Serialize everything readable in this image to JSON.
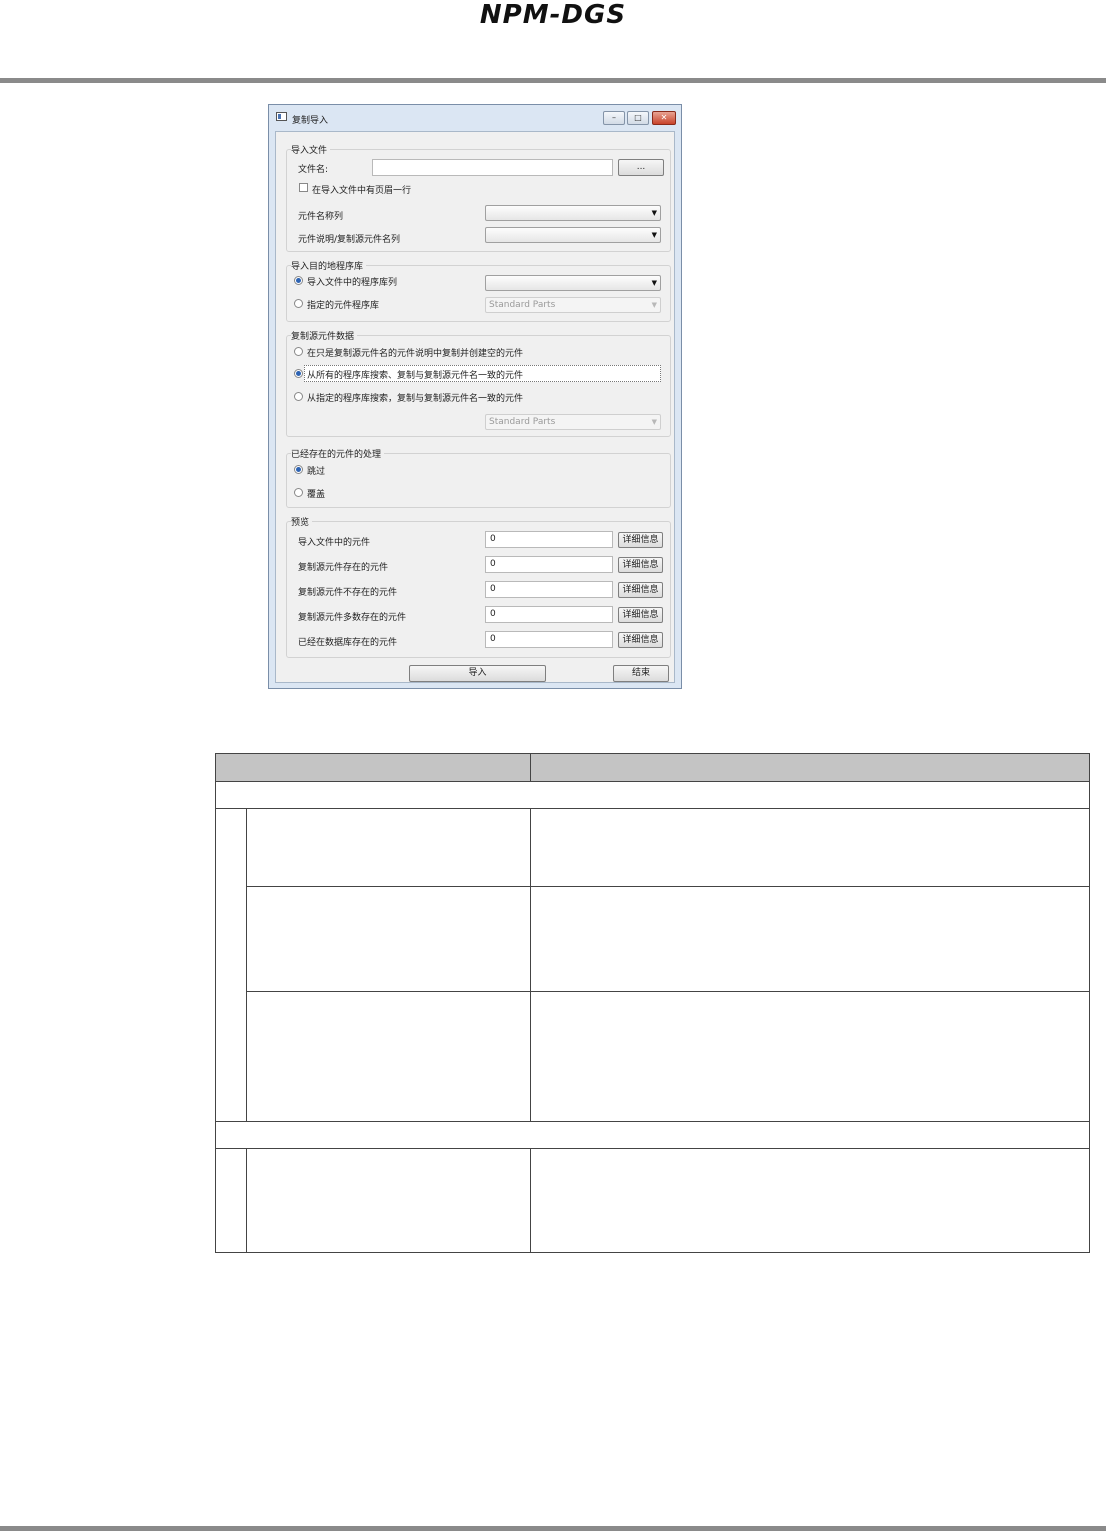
{
  "header": {
    "title": "NPM-DGS"
  },
  "dialog": {
    "title": "复制导入",
    "window_buttons": {
      "minimize": "–",
      "maximize": "□",
      "close": "✕"
    },
    "import_file_group": {
      "title": "导入文件",
      "filename_label": "文件名:",
      "filename_value": "",
      "browse_label": "...",
      "header_row_checkbox_label": "在导入文件中有页眉一行",
      "header_row_checked": false,
      "component_name_col_label": "元件名称列",
      "component_name_col_value": "",
      "description_col_label": "元件说明/复制源元件名列",
      "description_col_value": ""
    },
    "destination_group": {
      "title": "导入目的地程序库",
      "option_file_label": "导入文件中的程序库列",
      "option_file_selected": true,
      "option_file_combo_value": "",
      "option_specified_label": "指定的元件程序库",
      "option_specified_selected": false,
      "option_specified_combo_value": "Standard Parts"
    },
    "copy_source_group": {
      "title": "复制源元件数据",
      "option1_label": "在只是复制源元件名的元件说明中复制并创建空的元件",
      "option2_label": "从所有的程序库搜索、复制与复制源元件名一致的元件",
      "option3_label": "从指定的程序库搜索，复制与复制源元件名一致的元件",
      "selected_option": 2,
      "library_combo_value": "Standard Parts"
    },
    "existing_group": {
      "title": "已经存在的元件的处理",
      "skip_label": "跳过",
      "overwrite_label": "覆盖",
      "selected": "skip"
    },
    "preview_group": {
      "title": "预览",
      "detail_label": "详细信息",
      "rows": [
        {
          "label": "导入文件中的元件",
          "value": "0"
        },
        {
          "label": "复制源元件存在的元件",
          "value": "0"
        },
        {
          "label": "复制源元件不存在的元件",
          "value": "0"
        },
        {
          "label": "复制源元件多数存在的元件",
          "value": "0"
        },
        {
          "label": "已经在数据库存在的元件",
          "value": "0"
        }
      ]
    },
    "import_button": "导入",
    "close_button": "结束"
  }
}
